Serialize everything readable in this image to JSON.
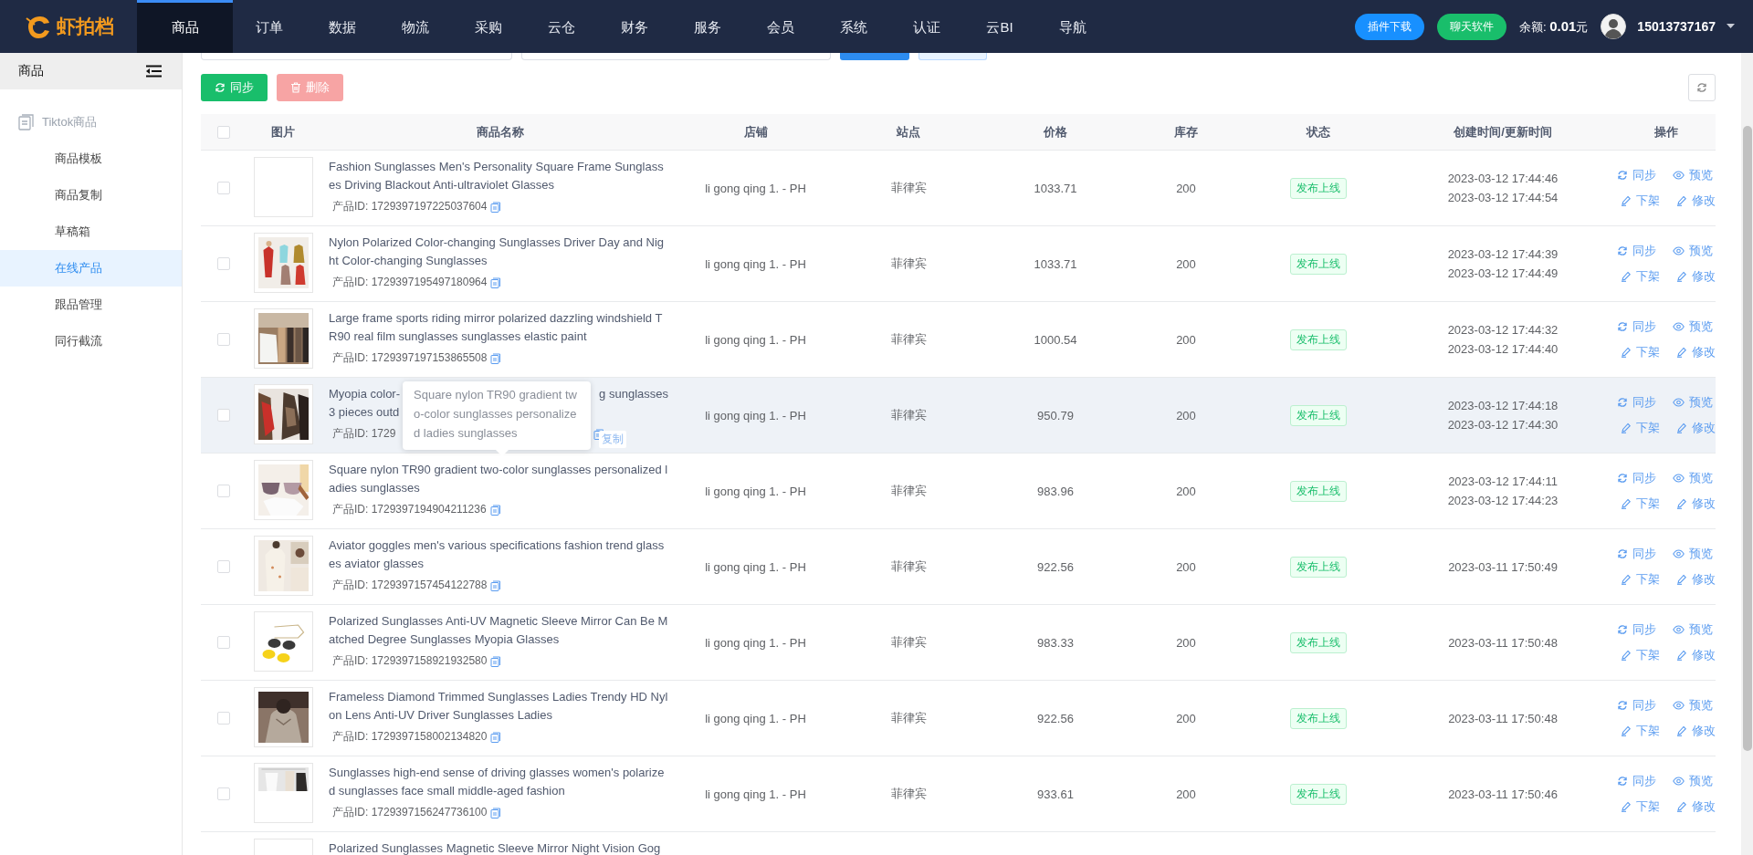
{
  "logo": {
    "text": "虾拍档"
  },
  "nav": [
    {
      "label": "商品",
      "selected": true
    },
    {
      "label": "订单",
      "selected": false
    },
    {
      "label": "数据",
      "selected": false
    },
    {
      "label": "物流",
      "selected": false
    },
    {
      "label": "采购",
      "selected": false
    },
    {
      "label": "云仓",
      "selected": false
    },
    {
      "label": "财务",
      "selected": false
    },
    {
      "label": "服务",
      "selected": false
    },
    {
      "label": "会员",
      "selected": false
    },
    {
      "label": "系统",
      "selected": false
    },
    {
      "label": "认证",
      "selected": false
    },
    {
      "label": "云BI",
      "selected": false
    },
    {
      "label": "导航",
      "selected": false
    }
  ],
  "header_right": {
    "plugin_button": "插件下载",
    "chat_button": "聊天软件",
    "balance": "余额: **0.01**元",
    "phone": "15013737167"
  },
  "sidebar": {
    "title": "商品",
    "group": "Tiktok商品",
    "items": [
      {
        "label": "商品模板",
        "selected": false
      },
      {
        "label": "商品复制",
        "selected": false
      },
      {
        "label": "草稿箱",
        "selected": false
      },
      {
        "label": "在线产品",
        "selected": true
      },
      {
        "label": "跟品管理",
        "selected": false
      },
      {
        "label": "同行截流",
        "selected": false
      }
    ]
  },
  "toolbar": {
    "buttons": [
      {
        "label": "同步",
        "kind": "sync",
        "disabled": false
      },
      {
        "label": "删除",
        "kind": "delete",
        "disabled": true
      }
    ]
  },
  "table": {
    "header_checked": false,
    "columns": [
      "图片",
      "商品名称",
      "店铺",
      "站点",
      "价格",
      "库存",
      "状态",
      "创建时间/更新时间",
      "操作"
    ],
    "rows": [
      {
        "checked": false,
        "highlighted": false,
        "has_picture": false,
        "name": "Fashion Sunglasses Men's Personality Square Frame Sunglasses Driving Blackout Anti-ultraviolet Glasses",
        "id_label": "产品ID: 1729397197225037604",
        "shop": "li gong qing 1. - PH",
        "site": "菲律宾",
        "price": "1033.71",
        "stock": "200",
        "status": "发布上线",
        "times": [
          "2023-03-12 17:44:46",
          "2023-03-12 17:44:54"
        ],
        "actions": [
          "同步",
          "预览",
          "下架",
          "修改"
        ]
      },
      {
        "checked": false,
        "highlighted": false,
        "has_picture": true,
        "name": "Nylon Polarized Color-changing Sunglasses Driver Day and Night Color-changing Sunglasses",
        "id_label": "产品ID: 1729397195497180964",
        "shop": "li gong qing 1. - PH",
        "site": "菲律宾",
        "price": "1033.71",
        "stock": "200",
        "status": "发布上线",
        "times": [
          "2023-03-12 17:44:39",
          "2023-03-12 17:44:49"
        ],
        "actions": [
          "同步",
          "预览",
          "下架",
          "修改"
        ]
      },
      {
        "checked": false,
        "highlighted": false,
        "has_picture": true,
        "name": "Large frame sports riding mirror polarized dazzling windshield TR90 real film sunglasses sunglasses elastic paint",
        "id_label": "产品ID: 1729397197153865508",
        "shop": "li gong qing 1. - PH",
        "site": "菲律宾",
        "price": "1000.54",
        "stock": "200",
        "status": "发布上线",
        "times": [
          "2023-03-12 17:44:32",
          "2023-03-12 17:44:40"
        ],
        "actions": [
          "同步",
          "预览",
          "下架",
          "修改"
        ]
      },
      {
        "checked": false,
        "highlighted": true,
        "has_picture": true,
        "name_parts": [
          "Myopia color-",
          "g sunglasses",
          "3 pieces outd"
        ],
        "id_label": "产品ID: 1729",
        "shop": "li gong qing 1. - PH",
        "site": "菲律宾",
        "price": "950.79",
        "stock": "200",
        "status": "发布上线",
        "times": [
          "2023-03-12 17:44:18",
          "2023-03-12 17:44:30"
        ],
        "actions": [
          "同步",
          "预览",
          "下架",
          "修改"
        ],
        "tooltip": {
          "text": "Square nylon TR90 gradient two-color sunglasses personalized ladies sunglasses",
          "copy_label": "复制"
        }
      },
      {
        "checked": false,
        "highlighted": false,
        "has_picture": true,
        "name": "Square nylon TR90 gradient two-color sunglasses personalized ladies sunglasses",
        "id_label": "产品ID: 1729397194904211236",
        "shop": "li gong qing 1. - PH",
        "site": "菲律宾",
        "price": "983.96",
        "stock": "200",
        "status": "发布上线",
        "times": [
          "2023-03-12 17:44:11",
          "2023-03-12 17:44:23"
        ],
        "actions": [
          "同步",
          "预览",
          "下架",
          "修改"
        ]
      },
      {
        "checked": false,
        "highlighted": false,
        "has_picture": true,
        "name": "Aviator goggles men's various specifications fashion trend glasses aviator glasses",
        "id_label": "产品ID: 1729397157454122788",
        "shop": "li gong qing 1. - PH",
        "site": "菲律宾",
        "price": "922.56",
        "stock": "200",
        "status": "发布上线",
        "times": [
          "2023-03-11 17:50:49"
        ],
        "actions": [
          "同步",
          "预览",
          "下架",
          "修改"
        ]
      },
      {
        "checked": false,
        "highlighted": false,
        "has_picture": true,
        "name": "Polarized Sunglasses Anti-UV Magnetic Sleeve Mirror Can Be Matched Degree Sunglasses Myopia Glasses",
        "id_label": "产品ID: 1729397158921932580",
        "shop": "li gong qing 1. - PH",
        "site": "菲律宾",
        "price": "983.33",
        "stock": "200",
        "status": "发布上线",
        "times": [
          "2023-03-11 17:50:48"
        ],
        "actions": [
          "同步",
          "预览",
          "下架",
          "修改"
        ]
      },
      {
        "checked": false,
        "highlighted": false,
        "has_picture": true,
        "name": "Frameless Diamond Trimmed Sunglasses Ladies Trendy HD Nylon Lens Anti-UV Driver Sunglasses Ladies",
        "id_label": "产品ID: 1729397158002134820",
        "shop": "li gong qing 1. - PH",
        "site": "菲律宾",
        "price": "922.56",
        "stock": "200",
        "status": "发布上线",
        "times": [
          "2023-03-11 17:50:48"
        ],
        "actions": [
          "同步",
          "预览",
          "下架",
          "修改"
        ]
      },
      {
        "checked": false,
        "highlighted": false,
        "has_picture": true,
        "name": "Sunglasses high-end sense of driving glasses women's polarized sunglasses face small middle-aged fashion",
        "id_label": "产品ID: 1729397156247736100",
        "shop": "li gong qing 1. - PH",
        "site": "菲律宾",
        "price": "933.61",
        "stock": "200",
        "status": "发布上线",
        "times": [
          "2023-03-11 17:50:46"
        ],
        "actions": [
          "同步",
          "预览",
          "下架",
          "修改"
        ]
      },
      {
        "highlighted": false,
        "has_picture": false,
        "name": "Polarized Sunglasses Magnetic Sleeve Mirror Night Vision Gog"
      }
    ]
  }
}
